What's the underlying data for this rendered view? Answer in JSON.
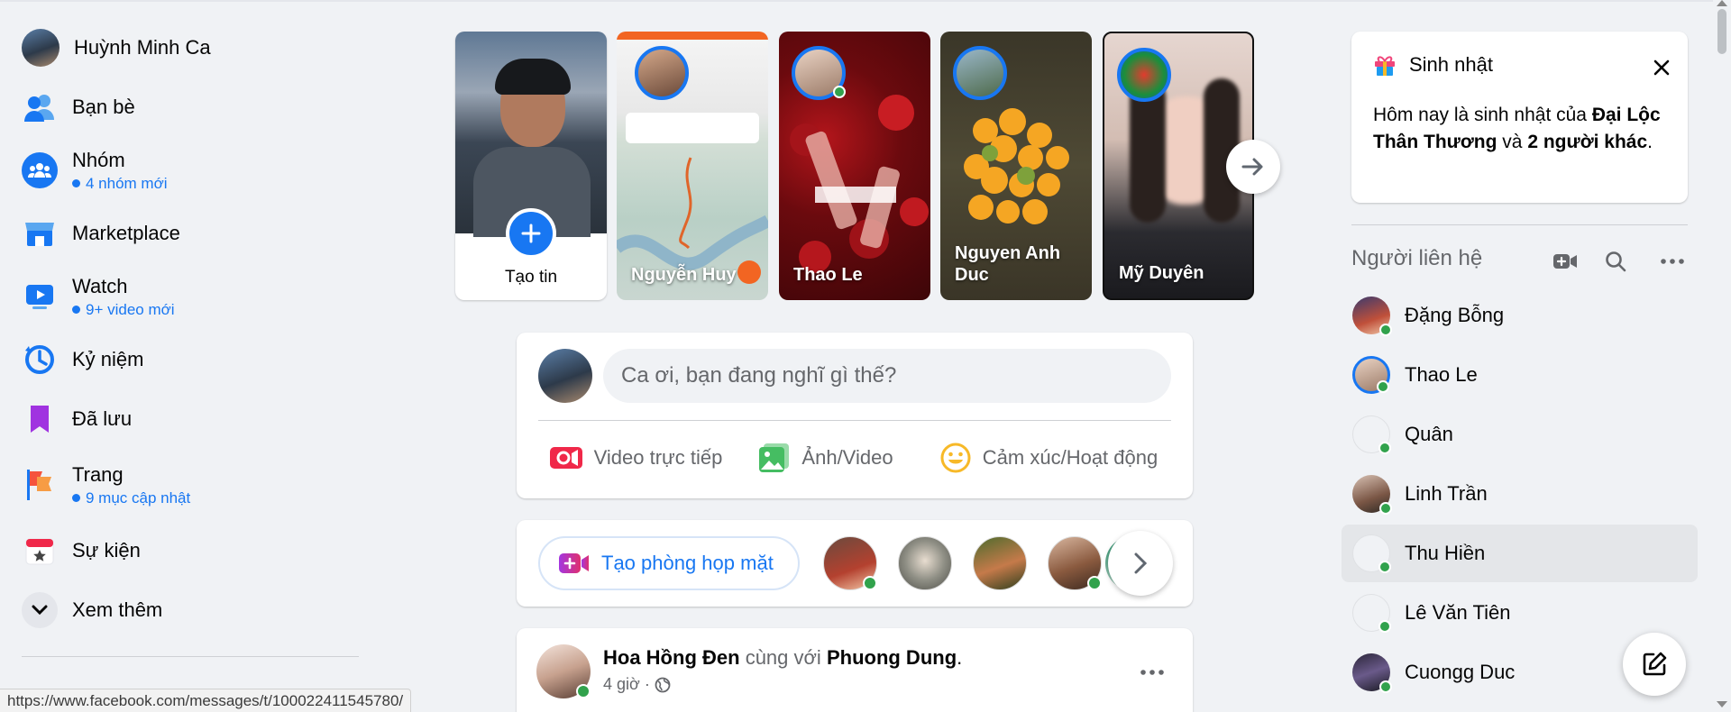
{
  "sidebar": {
    "profile_name": "Huỳnh Minh Ca",
    "items": [
      {
        "label": "Bạn bè",
        "sub": ""
      },
      {
        "label": "Nhóm",
        "sub": "4 nhóm mới"
      },
      {
        "label": "Marketplace",
        "sub": ""
      },
      {
        "label": "Watch",
        "sub": "9+ video mới"
      },
      {
        "label": "Kỷ niệm",
        "sub": ""
      },
      {
        "label": "Đã lưu",
        "sub": ""
      },
      {
        "label": "Trang",
        "sub": "9 mục cập nhật"
      },
      {
        "label": "Sự kiện",
        "sub": ""
      },
      {
        "label": "Xem thêm",
        "sub": ""
      }
    ]
  },
  "status_url": "https://www.facebook.com/messages/t/100022411545780/",
  "stories": {
    "create_label": "Tạo tin",
    "items": [
      "Nguyễn Huy",
      "Thao Le",
      "Nguyen Anh Duc",
      "Mỹ Duyên"
    ]
  },
  "composer": {
    "placeholder": "Ca ơi, bạn đang nghĩ gì thế?",
    "actions": [
      "Video trực tiếp",
      "Ảnh/Video",
      "Cảm xúc/Hoạt động"
    ]
  },
  "rooms": {
    "create_label": "Tạo phòng họp mặt"
  },
  "post": {
    "author": "Hoa Hồng Đen",
    "with_text": "cùng với",
    "tagged": "Phuong Dung",
    "time": "4 giờ ·"
  },
  "birthday": {
    "title": "Sinh nhật",
    "text_prefix": "Hôm nay là sinh nhật của",
    "name": "Đại Lộc Thân Thương",
    "text_middle": "và",
    "others": "2 người khác",
    "suffix": "."
  },
  "contacts": {
    "title": "Người liên hệ",
    "items": [
      "Đặng Bỗng",
      "Thao Le",
      "Quân",
      "Linh Trần",
      "Thu Hiền",
      "Lê Văn Tiên",
      "Cuongg Duc"
    ]
  },
  "colors": {
    "accent": "#1877f2",
    "online": "#31a24c",
    "bg": "#f0f2f5"
  }
}
